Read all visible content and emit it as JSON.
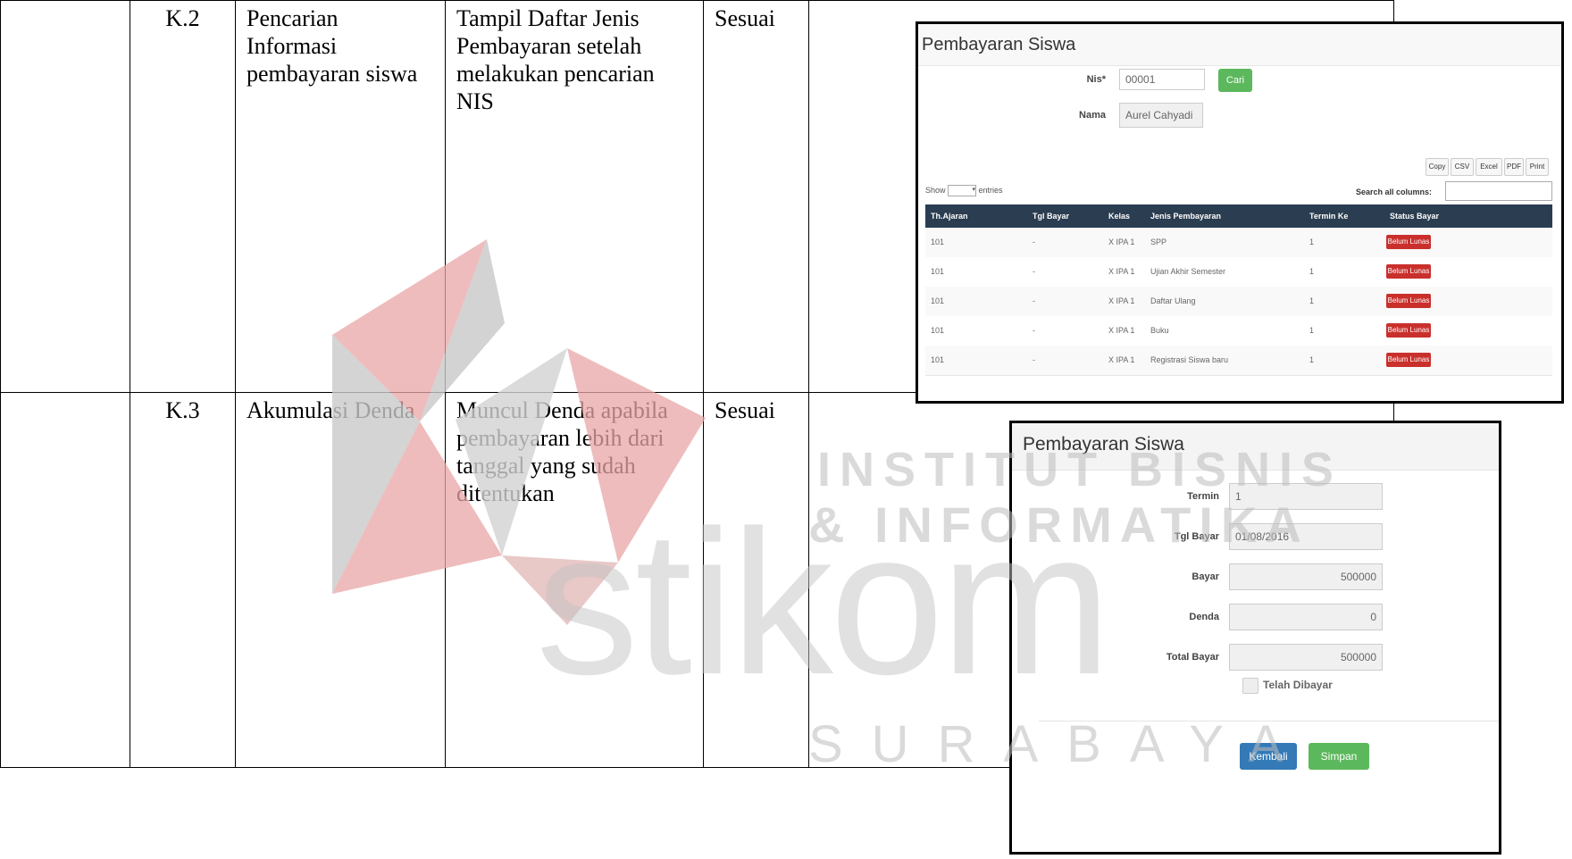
{
  "rows": [
    {
      "id": "K.2",
      "test_case": "Pencarian Informasi pembayaran siswa",
      "expected": "Tampil Daftar Jenis Pembayaran setelah melakukan pencarian NIS",
      "result": "Sesuai"
    },
    {
      "id": "K.3",
      "test_case": "Akumulasi Denda",
      "expected": "Muncul Denda apabila pembayaran lebih dari tanggal yang sudah ditentukan",
      "result": "Sesuai"
    }
  ],
  "shot1": {
    "title": "Pembayaran Siswa",
    "nis_label": "Nis*",
    "nis_value": "00001",
    "cari_label": "Cari",
    "nama_label": "Nama",
    "nama_value": "Aurel Cahyadi",
    "export_buttons": [
      "Copy",
      "CSV",
      "Excel",
      "PDF",
      "Print"
    ],
    "show_label": "Show",
    "entries_label": "entries",
    "search_label": "Search all columns:",
    "columns": [
      "Th.Ajaran",
      "Tgl Bayar",
      "Kelas",
      "Jenis Pembayaran",
      "Termin Ke",
      "Status Bayar"
    ],
    "rows": [
      [
        "101",
        "-",
        "X IPA 1",
        "SPP",
        "1",
        "Belum Lunas"
      ],
      [
        "101",
        "-",
        "X IPA 1",
        "Ujian Akhir Semester",
        "1",
        "Belum Lunas"
      ],
      [
        "101",
        "-",
        "X IPA 1",
        "Daftar Ulang",
        "1",
        "Belum Lunas"
      ],
      [
        "101",
        "-",
        "X IPA 1",
        "Buku",
        "1",
        "Belum Lunas"
      ],
      [
        "101",
        "-",
        "X IPA 1",
        "Registrasi Siswa baru",
        "1",
        "Belum Lunas"
      ]
    ]
  },
  "shot2": {
    "title": "Pembayaran Siswa",
    "fields": [
      {
        "label": "Termin",
        "value": "1",
        "align": "left"
      },
      {
        "label": "Tgl Bayar",
        "value": "01/08/2016",
        "align": "left"
      },
      {
        "label": "Bayar",
        "value": "500000",
        "align": "right"
      },
      {
        "label": "Denda",
        "value": "0",
        "align": "right"
      },
      {
        "label": "Total Bayar",
        "value": "500000",
        "align": "right"
      }
    ],
    "checkbox_label": "Telah Dibayar",
    "kembali_label": "Kembali",
    "simpan_label": "Simpan"
  },
  "watermark": {
    "line1": "INSTITUT BISNIS",
    "line2": "& INFORMATIKA",
    "brand": "stikom",
    "city": "SURABAYA"
  }
}
